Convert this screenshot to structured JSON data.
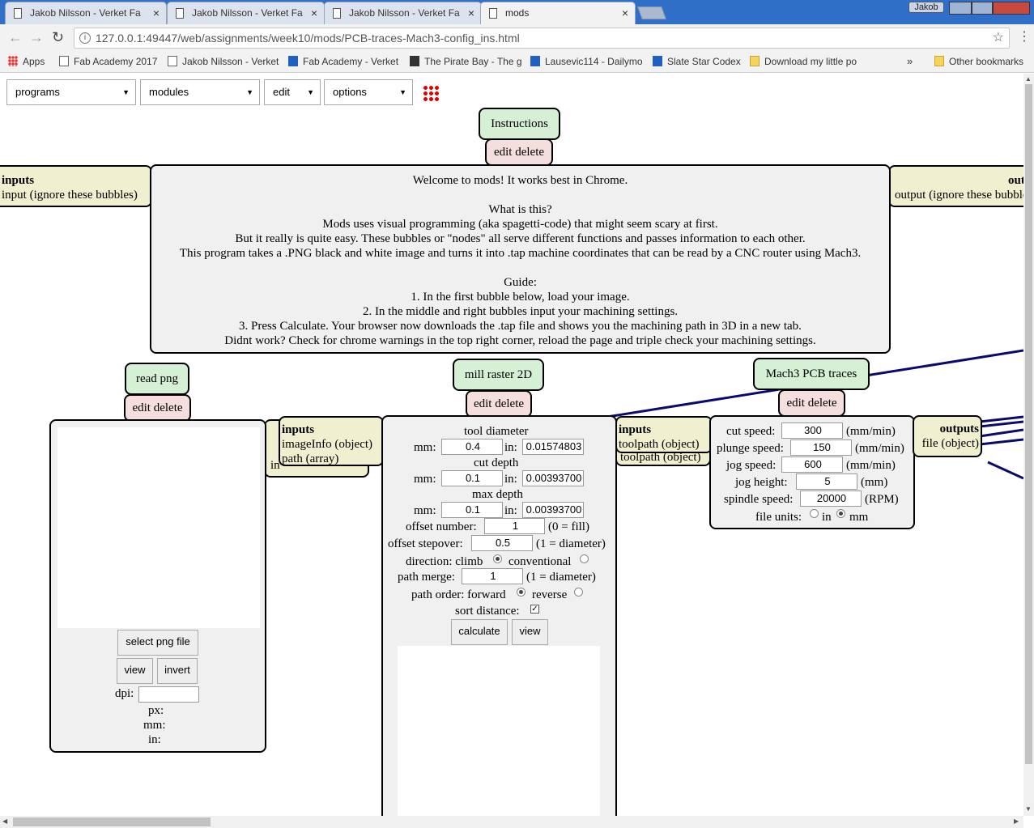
{
  "browser": {
    "tabs": [
      {
        "label": "Jakob Nilsson - Verket Fa"
      },
      {
        "label": "Jakob Nilsson - Verket Fa"
      },
      {
        "label": "Jakob Nilsson - Verket Fa"
      },
      {
        "label": "mods"
      }
    ],
    "user": "Jakob",
    "url": "127.0.0.1:49447/web/assignments/week10/mods/PCB-traces-Mach3-config_ins.html",
    "bookmarks": [
      {
        "label": "Apps",
        "icon": "apps-grid-icon"
      },
      {
        "label": "Fab Academy 2017",
        "icon": "page-icon"
      },
      {
        "label": "Jakob Nilsson - Verket",
        "icon": "page-icon"
      },
      {
        "label": "Fab Academy - Verket",
        "icon": "calendar-icon"
      },
      {
        "label": "The Pirate Bay - The g",
        "icon": "pirate-ship-icon"
      },
      {
        "label": "Lausevic114 - Dailymo",
        "icon": "dailymotion-icon"
      },
      {
        "label": "Slate Star Codex",
        "icon": "slate-icon"
      },
      {
        "label": "Download my little po",
        "icon": "shield-icon"
      }
    ],
    "overflow": "»",
    "other_bookmarks": "Other bookmarks"
  },
  "menus": {
    "programs": "programs",
    "modules": "modules",
    "edit": "edit",
    "options": "options"
  },
  "instructions": {
    "title": "Instructions",
    "edit_delete": "edit delete",
    "inputs_title": "inputs",
    "inputs_text": "input (ignore these bubbles)",
    "outputs_title": "outputs",
    "outputs_text": "output (ignore these bubbles)",
    "lines": [
      "Welcome to mods! It works best in Chrome.",
      "",
      "What is this?",
      "Mods uses visual programming (aka spagetti-code) that might seem scary at first.",
      "But it really is quite easy. These bubbles or \"nodes\" all serve different functions and passes information to each other.",
      "This program takes a .PNG black and white image and turns it into .tap machine coordinates that can be read by a CNC router using Mach3.",
      "",
      "Guide:",
      "1. In the first bubble below, load your image.",
      "2. In the middle and right bubbles input your machining settings.",
      "3. Press Calculate. Your browser now downloads the .tap file and shows you the machining path in 3D in a new tab.",
      "Didnt work? Check for chrome warnings in the top right corner, reload the page and triple check your machining settings."
    ]
  },
  "read_png": {
    "title": "read png",
    "edit_delete": "edit delete",
    "select_button": "select png file",
    "view_button": "view",
    "invert_button": "invert",
    "dpi_label": "dpi:",
    "dpi_value": "",
    "px_label": "px:",
    "mm_label": "mm:",
    "in_label": "in:",
    "outputs_title": "inputs",
    "outputs_lines": [
      "imageInfo (object)",
      "path (array)"
    ],
    "hidden_label": "in"
  },
  "mill_raster": {
    "title": "mill raster 2D",
    "edit_delete": "edit delete",
    "tool_diameter": "tool diameter",
    "cut_depth": "cut depth",
    "max_depth": "max depth",
    "mm_label": "mm:",
    "in_label": "in:",
    "tool_mm": "0.4",
    "tool_in": "0.01574803",
    "cut_mm": "0.1",
    "cut_in": "0.00393700",
    "max_mm": "0.1",
    "max_in": "0.00393700",
    "offset_number_label": "offset number:",
    "offset_number": "1",
    "offset_number_hint": "(0 = fill)",
    "offset_stepover_label": "offset stepover:",
    "offset_stepover": "0.5",
    "offset_stepover_hint": "(1 = diameter)",
    "direction_label": "direction: climb",
    "direction_alt": "conventional",
    "path_merge_label": "path merge:",
    "path_merge": "1",
    "path_merge_hint": "(1 = diameter)",
    "path_order_label": "path order: forward",
    "path_order_alt": "reverse",
    "sort_distance_label": "sort distance:",
    "calculate_button": "calculate",
    "view_button": "view",
    "outputs_title": "inputs",
    "outputs_line": "toolpath (object)",
    "outputs_shadow": "toolpath (object)"
  },
  "mach3": {
    "title": "Mach3 PCB traces",
    "edit_delete": "edit delete",
    "cut_speed_label": "cut speed:",
    "cut_speed": "300",
    "cut_speed_unit": "(mm/min)",
    "plunge_speed_label": "plunge speed:",
    "plunge_speed": "150",
    "plunge_speed_unit": "(mm/min)",
    "jog_speed_label": "jog speed:",
    "jog_speed": "600",
    "jog_speed_unit": "(mm/min)",
    "jog_height_label": "jog height:",
    "jog_height": "5",
    "jog_height_unit": "(mm)",
    "spindle_speed_label": "spindle speed:",
    "spindle_speed": "20000",
    "spindle_speed_unit": "(RPM)",
    "file_units_label": "file units:",
    "unit_in": "in",
    "unit_mm": "mm",
    "outputs_title": "outputs",
    "outputs_line": "file (object)"
  },
  "colors": {
    "wire": "#0a0a6e",
    "node_green": "#d6f0d6",
    "node_pink": "#f5dede",
    "node_yellow": "#f0f0d0",
    "node_gray": "#f0f0f0"
  }
}
